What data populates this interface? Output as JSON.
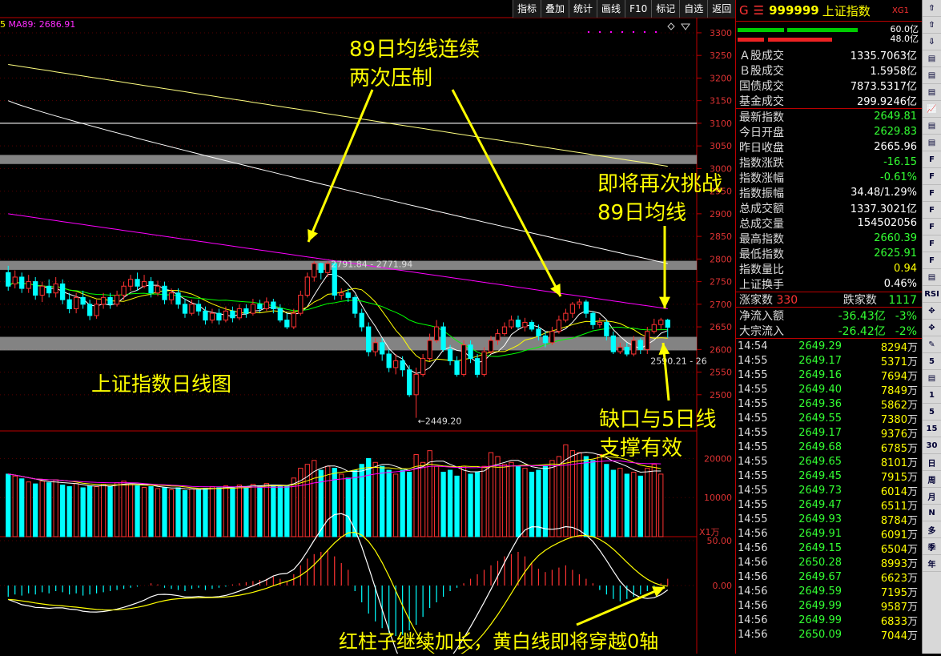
{
  "toolbar": {
    "items": [
      "指标",
      "叠加",
      "统计",
      "画线",
      "F10",
      "标记",
      "自选",
      "返回"
    ]
  },
  "ma_label": {
    "prefix": "5",
    "text": "MA89: 2686.91"
  },
  "annotations": {
    "a1": "89日均线连续",
    "a2": "两次压制",
    "a3": "即将再次挑战",
    "a4": "89日均线",
    "a5": "缺口与5日线",
    "a6": "支撑有效",
    "a7": "上证指数日线图",
    "a8": "红柱子继续加长，黄白线即将穿越0轴"
  },
  "price_labels": {
    "high": "2791.84 - 2771.94",
    "low": "2449.20",
    "recent_low": "2590.21 - 26"
  },
  "vol_unit": "X1万",
  "colors": {
    "up": "#ff3232",
    "down": "#00ffff",
    "ma5": "#ffffff",
    "ma10": "#ffff00",
    "ma20": "#ff00ff",
    "ma30": "#00ff00",
    "ma60": "#ffffff",
    "ma120": "#ffff80",
    "annot": "#ffff00",
    "panel_border": "#b00000"
  },
  "chart_data": {
    "type": "candlestick",
    "title": "上证指数日线图",
    "price_axis": {
      "ticks": [
        3300,
        3250,
        3200,
        3150,
        3100,
        3050,
        3000,
        2950,
        2900,
        2850,
        2800,
        2750,
        2700,
        2650,
        2600,
        2550,
        2500
      ],
      "ylim": [
        2420,
        3330
      ]
    },
    "volume_axis": {
      "ticks": [
        20000,
        10000
      ],
      "unit": "X1万"
    },
    "macd_axis": {
      "ticks": [
        "50.00",
        "0.00"
      ]
    },
    "candles": [
      [
        2770,
        2740,
        2785,
        2730
      ],
      [
        2745,
        2760,
        2775,
        2735
      ],
      [
        2760,
        2735,
        2770,
        2725
      ],
      [
        2735,
        2750,
        2765,
        2725
      ],
      [
        2750,
        2720,
        2760,
        2710
      ],
      [
        2720,
        2740,
        2750,
        2705
      ],
      [
        2740,
        2725,
        2755,
        2715
      ],
      [
        2725,
        2745,
        2760,
        2715
      ],
      [
        2745,
        2710,
        2755,
        2700
      ],
      [
        2710,
        2690,
        2725,
        2680
      ],
      [
        2690,
        2715,
        2725,
        2680
      ],
      [
        2715,
        2700,
        2730,
        2690
      ],
      [
        2700,
        2675,
        2710,
        2665
      ],
      [
        2675,
        2700,
        2710,
        2668
      ],
      [
        2700,
        2715,
        2725,
        2690
      ],
      [
        2715,
        2700,
        2725,
        2690
      ],
      [
        2700,
        2720,
        2730,
        2695
      ],
      [
        2720,
        2740,
        2750,
        2710
      ],
      [
        2740,
        2755,
        2765,
        2730
      ],
      [
        2755,
        2740,
        2770,
        2730
      ],
      [
        2740,
        2750,
        2765,
        2735
      ],
      [
        2750,
        2725,
        2760,
        2715
      ],
      [
        2725,
        2740,
        2752,
        2718
      ],
      [
        2740,
        2710,
        2750,
        2700
      ],
      [
        2710,
        2725,
        2735,
        2700
      ],
      [
        2725,
        2700,
        2735,
        2690
      ],
      [
        2700,
        2680,
        2712,
        2670
      ],
      [
        2680,
        2700,
        2710,
        2675
      ],
      [
        2700,
        2685,
        2710,
        2675
      ],
      [
        2685,
        2665,
        2695,
        2655
      ],
      [
        2665,
        2680,
        2690,
        2658
      ],
      [
        2680,
        2665,
        2690,
        2655
      ],
      [
        2665,
        2685,
        2695,
        2660
      ],
      [
        2685,
        2670,
        2695,
        2660
      ],
      [
        2670,
        2690,
        2700,
        2665
      ],
      [
        2690,
        2680,
        2700,
        2670
      ],
      [
        2680,
        2700,
        2712,
        2675
      ],
      [
        2700,
        2690,
        2710,
        2682
      ],
      [
        2690,
        2705,
        2715,
        2685
      ],
      [
        2705,
        2690,
        2712,
        2680
      ],
      [
        2690,
        2665,
        2700,
        2660
      ],
      [
        2665,
        2650,
        2680,
        2645
      ],
      [
        2650,
        2680,
        2690,
        2645
      ],
      [
        2680,
        2720,
        2730,
        2675
      ],
      [
        2720,
        2760,
        2770,
        2715
      ],
      [
        2760,
        2790,
        2795,
        2750
      ],
      [
        2790,
        2770,
        2792,
        2755
      ],
      [
        2770,
        2790,
        2795,
        2760
      ],
      [
        2790,
        2720,
        2795,
        2710
      ],
      [
        2720,
        2725,
        2735,
        2710
      ],
      [
        2725,
        2715,
        2735,
        2705
      ],
      [
        2715,
        2680,
        2720,
        2670
      ],
      [
        2680,
        2650,
        2690,
        2640
      ],
      [
        2650,
        2595,
        2660,
        2585
      ],
      [
        2595,
        2615,
        2625,
        2585
      ],
      [
        2615,
        2590,
        2625,
        2575
      ],
      [
        2590,
        2560,
        2600,
        2550
      ],
      [
        2560,
        2575,
        2590,
        2545
      ],
      [
        2575,
        2555,
        2585,
        2540
      ],
      [
        2555,
        2500,
        2565,
        2495
      ],
      [
        2500,
        2545,
        2560,
        2449
      ],
      [
        2545,
        2580,
        2590,
        2540
      ],
      [
        2580,
        2620,
        2635,
        2575
      ],
      [
        2620,
        2650,
        2665,
        2615
      ],
      [
        2650,
        2600,
        2660,
        2595
      ],
      [
        2600,
        2575,
        2610,
        2565
      ],
      [
        2575,
        2545,
        2585,
        2540
      ],
      [
        2545,
        2610,
        2620,
        2540
      ],
      [
        2610,
        2580,
        2620,
        2570
      ],
      [
        2580,
        2545,
        2590,
        2538
      ],
      [
        2545,
        2595,
        2605,
        2540
      ],
      [
        2595,
        2620,
        2630,
        2590
      ],
      [
        2620,
        2635,
        2645,
        2610
      ],
      [
        2635,
        2650,
        2660,
        2630
      ],
      [
        2650,
        2665,
        2675,
        2645
      ],
      [
        2665,
        2650,
        2675,
        2645
      ],
      [
        2650,
        2660,
        2670,
        2640
      ],
      [
        2660,
        2645,
        2665,
        2640
      ],
      [
        2645,
        2630,
        2655,
        2620
      ],
      [
        2630,
        2615,
        2640,
        2605
      ],
      [
        2615,
        2640,
        2650,
        2610
      ],
      [
        2640,
        2665,
        2675,
        2635
      ],
      [
        2665,
        2680,
        2690,
        2660
      ],
      [
        2680,
        2700,
        2705,
        2670
      ],
      [
        2700,
        2705,
        2712,
        2690
      ],
      [
        2705,
        2680,
        2710,
        2670
      ],
      [
        2680,
        2655,
        2685,
        2645
      ],
      [
        2655,
        2660,
        2670,
        2648
      ],
      [
        2660,
        2630,
        2665,
        2620
      ],
      [
        2630,
        2595,
        2640,
        2590
      ],
      [
        2595,
        2605,
        2615,
        2590
      ],
      [
        2605,
        2590,
        2615,
        2585
      ],
      [
        2590,
        2620,
        2630,
        2585
      ],
      [
        2620,
        2600,
        2625,
        2590
      ],
      [
        2600,
        2640,
        2650,
        2590
      ],
      [
        2640,
        2655,
        2668,
        2635
      ],
      [
        2655,
        2665,
        2670,
        2645
      ],
      [
        2665,
        2649,
        2668,
        2626
      ]
    ],
    "volume": [
      16000,
      15500,
      14800,
      14000,
      13500,
      14200,
      13800,
      14500,
      13200,
      12800,
      13600,
      12500,
      13000,
      12800,
      13400,
      12900,
      13800,
      14200,
      13500,
      13000,
      12600,
      12800,
      12300,
      12600,
      12000,
      12500,
      11800,
      12200,
      12000,
      12400,
      12800,
      12500,
      13000,
      12600,
      13200,
      12800,
      13400,
      13000,
      13600,
      13200,
      12800,
      13000,
      15000,
      17500,
      18500,
      19500,
      17000,
      18000,
      17500,
      16000,
      15000,
      17000,
      18500,
      20000,
      19000,
      18000,
      17000,
      16000,
      17000,
      16500,
      21000,
      19000,
      22000,
      18000,
      16500,
      17000,
      15500,
      18000,
      16000,
      16500,
      18000,
      21500,
      20500,
      18500,
      19000,
      18000,
      17500,
      16500,
      17000,
      18000,
      19500,
      20500,
      23500,
      22000,
      21500,
      20500,
      19500,
      21000,
      18500,
      17000,
      17500,
      16000,
      16500,
      15500,
      17500,
      18500,
      16000
    ],
    "macd_hist": [
      -10,
      -8,
      -9,
      -7,
      -8,
      -6,
      -7,
      -5,
      -6,
      -8,
      -7,
      -9,
      -8,
      -7,
      -6,
      -5,
      -4,
      -3,
      -2,
      -1,
      0,
      2,
      1,
      -2,
      -3,
      -4,
      -5,
      -3,
      -2,
      -4,
      -3,
      -2,
      -1,
      1,
      2,
      3,
      4,
      5,
      6,
      8,
      6,
      4,
      10,
      18,
      24,
      28,
      30,
      32,
      26,
      20,
      14,
      -5,
      -15,
      -25,
      -32,
      -38,
      -42,
      -45,
      -44,
      -40,
      -35,
      -28,
      -20,
      -15,
      -10,
      -5,
      -2,
      2,
      6,
      10,
      14,
      18,
      22,
      26,
      28,
      30,
      26,
      20,
      15,
      12,
      14,
      16,
      18,
      14,
      10,
      6,
      2,
      -4,
      -8,
      -12,
      -14,
      -12,
      -10,
      -8,
      -5,
      -2,
      2,
      6
    ]
  },
  "quote": {
    "code_prefix": "G",
    "code": "999999",
    "name": "上证指数",
    "tag": "XG1",
    "bars": [
      {
        "value": "60.0亿",
        "color": "#0c0",
        "from": 2,
        "to": 60,
        "from2": 64,
        "to2": 152
      },
      {
        "value": "48.0亿",
        "color": "#e22",
        "from": 2,
        "to": 35,
        "from2": 40,
        "to2": 120
      }
    ],
    "rows1": [
      {
        "label": "Ａ股成交",
        "value": "1335.7063亿",
        "color": "#fff"
      },
      {
        "label": "Ｂ股成交",
        "value": "1.5958亿",
        "color": "#fff"
      },
      {
        "label": "国债成交",
        "value": "7873.5317亿",
        "color": "#fff"
      },
      {
        "label": "基金成交",
        "value": "299.9246亿",
        "color": "#fff"
      }
    ],
    "rows2": [
      {
        "label": "最新指数",
        "value": "2649.81",
        "color": "#3f3"
      },
      {
        "label": "今日开盘",
        "value": "2629.83",
        "color": "#3f3"
      },
      {
        "label": "昨日收盘",
        "value": "2665.96",
        "color": "#fff"
      },
      {
        "label": "指数涨跌",
        "value": "-16.15",
        "color": "#3f3"
      },
      {
        "label": "指数涨幅",
        "value": "-0.61%",
        "color": "#3f3"
      },
      {
        "label": "指数振幅",
        "value": "34.48/1.29%",
        "color": "#fff"
      },
      {
        "label": "总成交额",
        "value": "1337.3021亿",
        "color": "#fff"
      },
      {
        "label": "总成交量",
        "value": "154502056",
        "color": "#fff"
      },
      {
        "label": "最高指数",
        "value": "2660.39",
        "color": "#3f3"
      },
      {
        "label": "最低指数",
        "value": "2625.91",
        "color": "#3f3"
      },
      {
        "label": "指数量比",
        "value": "0.94",
        "color": "#ff0"
      },
      {
        "label": "上证换手",
        "value": "0.46%",
        "color": "#fff"
      }
    ],
    "updown": {
      "up_label": "涨家数",
      "up": "330",
      "down_label": "跌家数",
      "down": "1117"
    },
    "flows": [
      {
        "label": "净流入额",
        "value": "-36.43亿",
        "pct": "-3%"
      },
      {
        "label": "大宗流入",
        "value": "-26.42亿",
        "pct": "-2%"
      }
    ],
    "ticks": [
      {
        "t": "14:54",
        "p": "2649.29",
        "q": "8294"
      },
      {
        "t": "14:55",
        "p": "2649.17",
        "q": "5371"
      },
      {
        "t": "14:55",
        "p": "2649.16",
        "q": "7694"
      },
      {
        "t": "14:55",
        "p": "2649.40",
        "q": "7849"
      },
      {
        "t": "14:55",
        "p": "2649.36",
        "q": "5862"
      },
      {
        "t": "14:55",
        "p": "2649.55",
        "q": "7380"
      },
      {
        "t": "14:55",
        "p": "2649.17",
        "q": "9376"
      },
      {
        "t": "14:55",
        "p": "2649.68",
        "q": "6785"
      },
      {
        "t": "14:55",
        "p": "2649.65",
        "q": "8101"
      },
      {
        "t": "14:55",
        "p": "2649.45",
        "q": "7915"
      },
      {
        "t": "14:55",
        "p": "2649.73",
        "q": "6014"
      },
      {
        "t": "14:55",
        "p": "2649.47",
        "q": "6511"
      },
      {
        "t": "14:55",
        "p": "2649.93",
        "q": "8784"
      },
      {
        "t": "14:56",
        "p": "2649.91",
        "q": "6091"
      },
      {
        "t": "14:56",
        "p": "2649.15",
        "q": "6504"
      },
      {
        "t": "14:56",
        "p": "2650.28",
        "q": "8993"
      },
      {
        "t": "14:56",
        "p": "2649.67",
        "q": "6623"
      },
      {
        "t": "14:56",
        "p": "2649.59",
        "q": "7195"
      },
      {
        "t": "14:56",
        "p": "2649.99",
        "q": "9587"
      },
      {
        "t": "14:56",
        "p": "2649.99",
        "q": "6833"
      },
      {
        "t": "14:56",
        "p": "2650.09",
        "q": "7044"
      }
    ],
    "tick_unit": "万"
  },
  "sidebar": [
    "1",
    "5",
    "15",
    "30",
    "日",
    "周",
    "月",
    "N",
    "多",
    "季",
    "年"
  ]
}
